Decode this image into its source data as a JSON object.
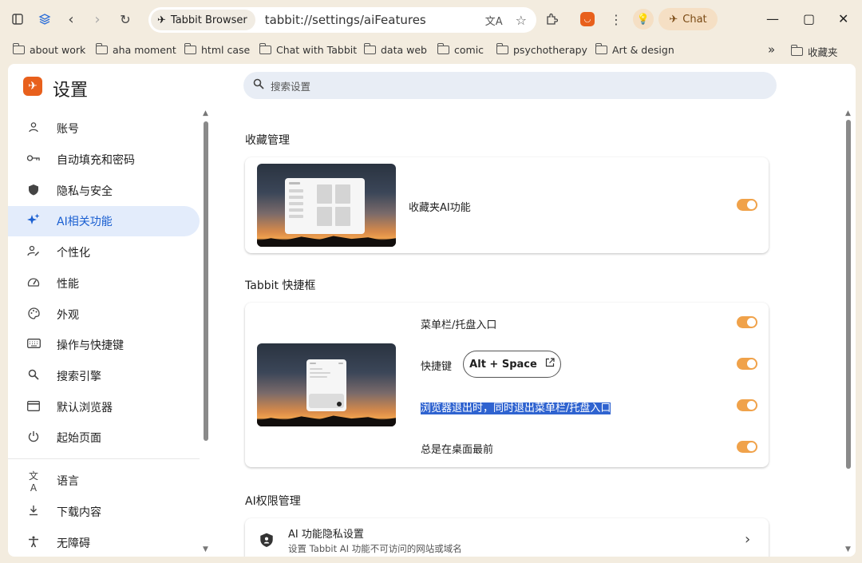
{
  "browser": {
    "tab_chip_label": "Tabbit Browser",
    "url": "tabbit://settings/aiFeatures",
    "chat_label": "Chat"
  },
  "bookmarks": [
    {
      "label": "about work"
    },
    {
      "label": "aha moment"
    },
    {
      "label": "html case"
    },
    {
      "label": "Chat with Tabbit"
    },
    {
      "label": "data web"
    },
    {
      "label": "comic"
    },
    {
      "label": "psychotherapy"
    },
    {
      "label": "Art & design"
    }
  ],
  "bookmarks_overflow": "»",
  "bookmarks_folder_right": "收藏夹",
  "sidebar": {
    "title": "设置",
    "items": [
      {
        "label": "账号",
        "icon": "person-icon"
      },
      {
        "label": "自动填充和密码",
        "icon": "key-icon"
      },
      {
        "label": "隐私与安全",
        "icon": "shield-icon"
      },
      {
        "label": "AI相关功能",
        "icon": "sparkle-icon"
      },
      {
        "label": "个性化",
        "icon": "person-edit-icon"
      },
      {
        "label": "性能",
        "icon": "gauge-icon"
      },
      {
        "label": "外观",
        "icon": "palette-icon"
      },
      {
        "label": "操作与快捷键",
        "icon": "keyboard-icon"
      },
      {
        "label": "搜索引擎",
        "icon": "search-icon"
      },
      {
        "label": "默认浏览器",
        "icon": "browser-icon"
      },
      {
        "label": "起始页面",
        "icon": "power-icon"
      },
      {
        "label": "语言",
        "icon": "translate-icon"
      },
      {
        "label": "下载内容",
        "icon": "download-icon"
      },
      {
        "label": "无障碍",
        "icon": "accessibility-icon"
      }
    ],
    "active_index": 3
  },
  "search": {
    "placeholder": "搜索设置"
  },
  "sections": {
    "favorites": {
      "title": "收藏管理",
      "row_label": "收藏夹AI功能",
      "toggle_on": true
    },
    "quickbox": {
      "title": "Tabbit 快捷框",
      "rows": [
        {
          "label": "菜单栏/托盘入口",
          "toggle_on": true
        },
        {
          "label": "快捷键",
          "toggle_on": true
        },
        {
          "label": "浏览器退出时，同时退出菜单栏/托盘入口",
          "toggle_on": true
        },
        {
          "label": "总是在桌面最前",
          "toggle_on": true
        }
      ],
      "hotkey": "Alt + Space"
    },
    "ai_permissions": {
      "title": "AI权限管理",
      "row_title": "AI 功能隐私设置",
      "row_subtitle": "设置 Tabbit AI 功能不可访问的网站或域名"
    }
  },
  "colors": {
    "accent_toggle": "#f0a24a",
    "active_nav_bg": "#e3ecfb",
    "active_nav_text": "#1a5fd1",
    "selection": "#2f63d0"
  }
}
